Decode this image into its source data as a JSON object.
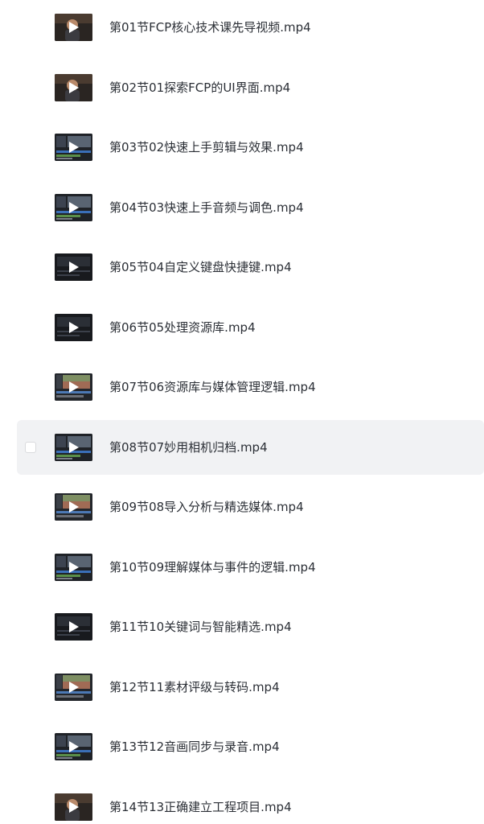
{
  "files": [
    {
      "name": "第01节FCP核心技术课先导视频.mp4",
      "thumb": "person"
    },
    {
      "name": "第02节01探索FCP的UI界面.mp4",
      "thumb": "person"
    },
    {
      "name": "第03节02快速上手剪辑与效果.mp4",
      "thumb": "editor"
    },
    {
      "name": "第04节03快速上手音频与调色.mp4",
      "thumb": "editor"
    },
    {
      "name": "第05节04自定义键盘快捷键.mp4",
      "thumb": "dark"
    },
    {
      "name": "第06节05处理资源库.mp4",
      "thumb": "dark"
    },
    {
      "name": "第07节06资源库与媒体管理逻辑.mp4",
      "thumb": "photo"
    },
    {
      "name": "第08节07妙用相机归档.mp4",
      "thumb": "editor",
      "hovered": true
    },
    {
      "name": "第09节08导入分析与精选媒体.mp4",
      "thumb": "photo"
    },
    {
      "name": "第10节09理解媒体与事件的逻辑.mp4",
      "thumb": "editor"
    },
    {
      "name": "第11节10关键词与智能精选.mp4",
      "thumb": "dark"
    },
    {
      "name": "第12节11素材评级与转码.mp4",
      "thumb": "photo"
    },
    {
      "name": "第13节12音画同步与录音.mp4",
      "thumb": "editor"
    },
    {
      "name": "第14节13正确建立工程项目.mp4",
      "thumb": "person"
    }
  ],
  "colors": {
    "text": "#2b2f36",
    "hover_bg": "#f1f2f4",
    "thumb_bg": "#1c1f24",
    "play_icon": "#ffffff"
  }
}
